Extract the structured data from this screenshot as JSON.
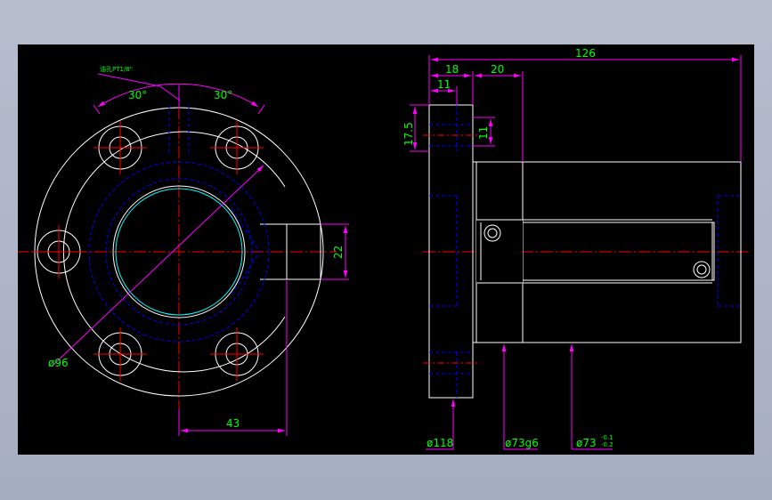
{
  "drawing": {
    "front_view": {
      "angle_left": "30°",
      "angle_right": "30°",
      "hole_note": "油孔PT1/8\"",
      "diameter_label": "ø96",
      "width_label": "43",
      "height_label": "22"
    },
    "side_view": {
      "overall_length": "126",
      "flange_thickness": "18",
      "step_length": "20",
      "small_length": "11",
      "height_left": "17.5",
      "height_right": "11",
      "dia_flange": "ø118",
      "dia_body": "ø73g6",
      "dia_bore": "ø73",
      "tol_upper": "-0.1",
      "tol_lower": "-0.2"
    }
  },
  "colors": {
    "background": "#000000",
    "frame": "#a6aec1",
    "outline": "#ffffff",
    "dimension": "#ff00ff",
    "dim_text": "#00ff00",
    "centerline": "#ff0000",
    "hidden": "#0000ff",
    "highlight": "#00ffff"
  }
}
